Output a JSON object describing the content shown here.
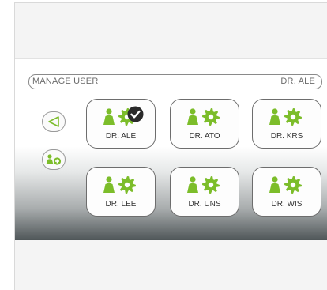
{
  "header": {
    "title": "MANAGE USER",
    "current_user": "DR. ALE"
  },
  "side": {
    "back_icon": "triangle-left-icon",
    "add_icon": "add-user-icon"
  },
  "accent_color": "#7cbd2a",
  "users": [
    {
      "name": "DR. ALE",
      "selected": true
    },
    {
      "name": "DR. ATO",
      "selected": false
    },
    {
      "name": "DR. KRS",
      "selected": false
    },
    {
      "name": "DR. LEE",
      "selected": false
    },
    {
      "name": "DR. UNS",
      "selected": false
    },
    {
      "name": "DR. WIS",
      "selected": false
    }
  ]
}
